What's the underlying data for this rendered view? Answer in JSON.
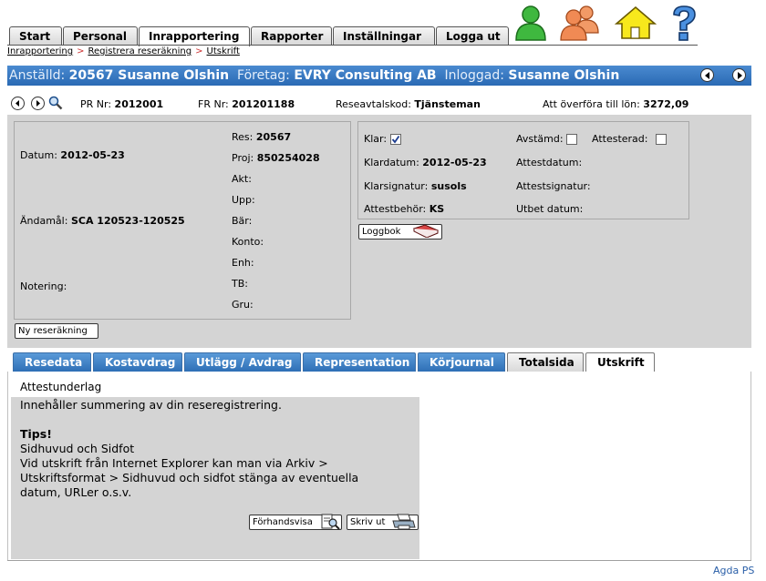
{
  "nav": {
    "tabs": [
      {
        "label": "Start",
        "active": false
      },
      {
        "label": "Personal",
        "active": false
      },
      {
        "label": "Inrapportering",
        "active": true
      },
      {
        "label": "Rapporter",
        "active": false
      },
      {
        "label": "Inställningar",
        "active": false
      },
      {
        "label": "Logga ut",
        "active": false
      }
    ],
    "icons": [
      "user-icon",
      "users-group-icon",
      "home-icon",
      "help-icon"
    ]
  },
  "breadcrumb": [
    "Inrapportering",
    "Registrera reseräkning",
    "Utskrift"
  ],
  "header": {
    "employee_label": "Anställd:",
    "employee_value": "20567 Susanne Olshin",
    "company_label": "Företag:",
    "company_value": "EVRY Consulting AB",
    "logged_in_label": "Inloggad:",
    "logged_in_value": "Susanne Olshin"
  },
  "info_row": {
    "pr_label": "PR Nr:",
    "pr_value": "2012001",
    "fr_label": "FR Nr:",
    "fr_value": "201201188",
    "code_label": "Reseavtalskod:",
    "code_value": "Tjänsteman",
    "transfer_label": "Att överföra till lön:",
    "transfer_value": "3272,09"
  },
  "left_box": {
    "datum_label": "Datum:",
    "datum_value": "2012-05-23",
    "andamal_label": "Ändamål:",
    "andamal_value": "SCA 120523-120525",
    "notering_label": "Notering:",
    "res_label": "Res:",
    "res_value": "20567",
    "proj_label": "Proj:",
    "proj_value": "850254028",
    "akt_label": "Akt:",
    "upp_label": "Upp:",
    "bar_label": "Bär:",
    "konto_label": "Konto:",
    "enh_label": "Enh:",
    "tb_label": "TB:",
    "gru_label": "Gru:"
  },
  "right_box": {
    "klar_label": "Klar:",
    "klar_checked": true,
    "avstamd_label": "Avstämd:",
    "avstamd_checked": false,
    "attesterad_label": "Attesterad:",
    "attesterad_checked": false,
    "klardatum_label": "Klardatum:",
    "klardatum_value": "2012-05-23",
    "klarsignatur_label": "Klarsignatur:",
    "klarsignatur_value": "susols",
    "attestbehor_label": "Attestbehör:",
    "attestbehor_value": "KS",
    "attestdatum_label": "Attestdatum:",
    "attestsignatur_label": "Attestsignatur:",
    "utbet_label": "Utbet datum:"
  },
  "buttons": {
    "loggbok": "Loggbok",
    "ny_reserakning": "Ny reseräkning",
    "forhandsvisa": "Förhandsvisa",
    "skriv_ut": "Skriv ut"
  },
  "section_tabs": [
    {
      "label": "Resedata",
      "style": "blue"
    },
    {
      "label": "Kostavdrag",
      "style": "blue"
    },
    {
      "label": "Utlägg / Avdrag",
      "style": "blue"
    },
    {
      "label": "Representation",
      "style": "blue"
    },
    {
      "label": "Körjournal",
      "style": "blue"
    },
    {
      "label": "Totalsida",
      "style": "gray"
    },
    {
      "label": "Utskrift",
      "style": "active"
    }
  ],
  "content": {
    "heading": "Attestunderlag",
    "summary": "Innehåller summering av din reseregistrering.",
    "tips_title": "Tips!",
    "tips_line1": "Sidhuvud och Sidfot",
    "tips_line2": "Vid utskrift från Internet Explorer kan man via Arkiv >",
    "tips_line3": "Utskriftsformat > Sidhuvud och sidfot stänga av eventuella",
    "tips_line4": "datum, URLer o.s.v."
  },
  "footer": {
    "brand": "Agda PS"
  },
  "colors": {
    "header_blue": "#2a6ab4",
    "tab_blue": "#3d82c8",
    "panel_gray": "#d4d4d4"
  }
}
